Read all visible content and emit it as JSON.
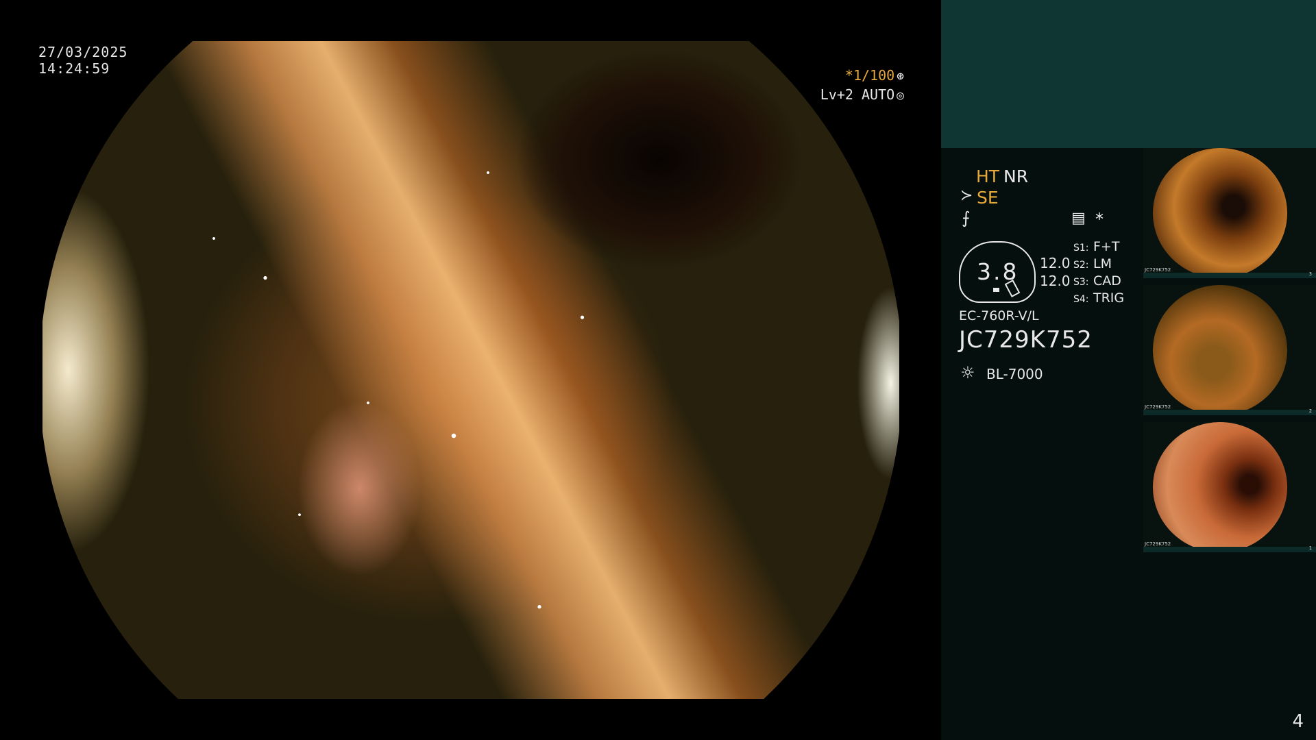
{
  "overlay": {
    "date": "27/03/2025",
    "time": "14:24:59",
    "shutter": "*1/100",
    "shutter_icon": "⊛",
    "level": "Lv+2 AUTO",
    "level_icon": "◎"
  },
  "panel": {
    "ht": "HT",
    "nr": "NR",
    "se_icon": "≻",
    "se": "SE",
    "filter_icon": "⨍",
    "menu_icon": "▤",
    "star_icon": "*",
    "zoom_value": "3.8",
    "mag_1": "12.0",
    "mag_2": "12.0",
    "switches": [
      {
        "key": "S1:",
        "value": "F+T"
      },
      {
        "key": "S2:",
        "value": "LM"
      },
      {
        "key": "S3:",
        "value": "CAD"
      },
      {
        "key": "S4:",
        "value": "TRIG"
      }
    ],
    "model": "EC-760R-V/L",
    "serial": "JC729K752",
    "light_icon": "☼",
    "light_source": "BL-7000"
  },
  "thumbnails": [
    {
      "label": "JC729K752",
      "number": "3"
    },
    {
      "label": "JC729K752",
      "number": "2"
    },
    {
      "label": "JC729K752",
      "number": "1"
    }
  ],
  "page_number": "4",
  "colors": {
    "accent": "#e7a93a",
    "panel_bg": "#050f0e",
    "panel_header": "#103634"
  }
}
